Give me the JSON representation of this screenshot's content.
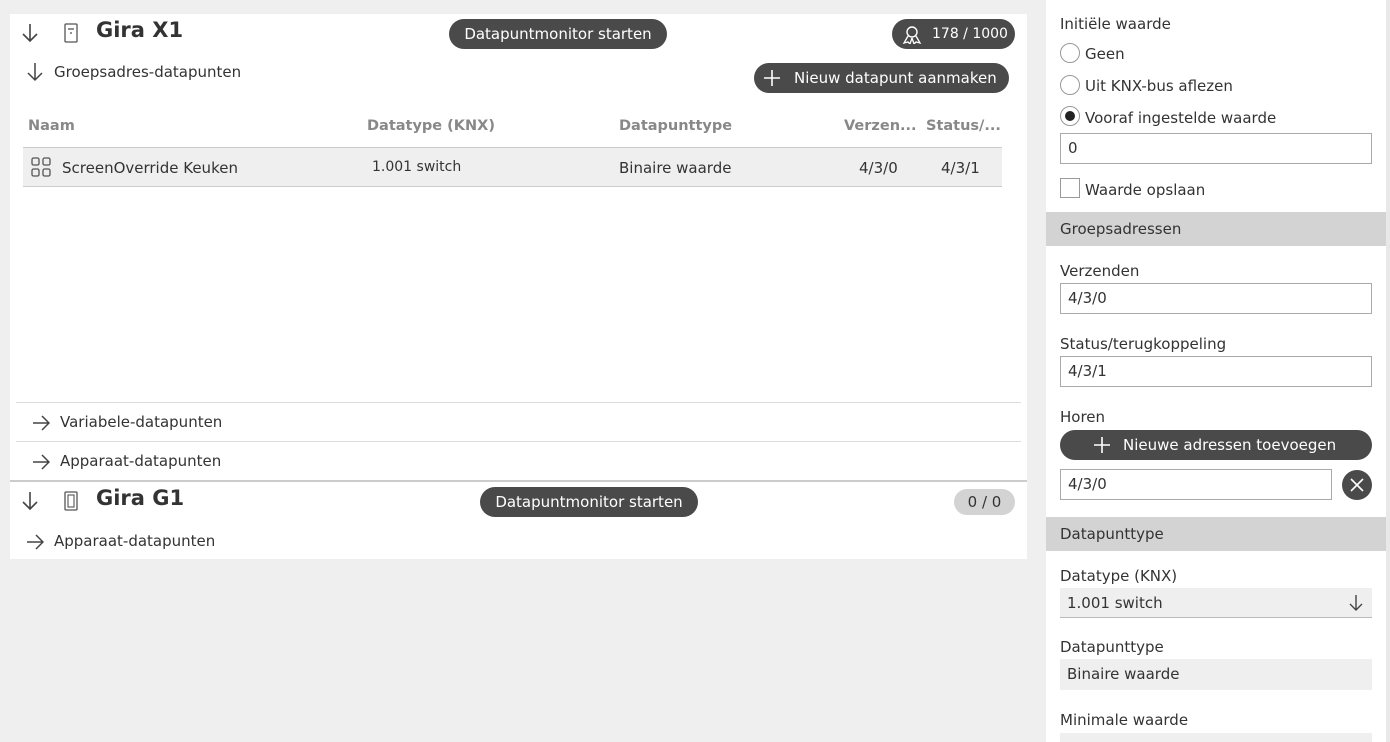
{
  "devices": [
    {
      "name": "Gira X1",
      "monitor_button": "Datapuntmonitor starten",
      "count": "178 / 1000",
      "sections": {
        "group": "Groepsadres-datapunten",
        "new_button": "Nieuw datapunt aanmaken",
        "variable": "Variabele-datapunten",
        "device": "Apparaat-datapunten"
      },
      "table": {
        "headers": [
          "Naam",
          "Datatype (KNX)",
          "Datapunttype",
          "Verzen...",
          "Status/..."
        ],
        "rows": [
          {
            "name": "ScreenOverride Keuken",
            "datatype": "1.001 switch",
            "dptype": "Binaire waarde",
            "send": "4/3/0",
            "status": "4/3/1"
          }
        ]
      }
    },
    {
      "name": "Gira G1",
      "monitor_button": "Datapuntmonitor starten",
      "count": "0 / 0",
      "sections": {
        "device": "Apparaat-datapunten"
      }
    }
  ],
  "panel": {
    "initial_value": {
      "label": "Initiële waarde",
      "options": [
        "Geen",
        "Uit KNX-bus aflezen",
        "Vooraf ingestelde waarde"
      ],
      "selected": "Vooraf ingestelde waarde",
      "value": "0",
      "save_label": "Waarde opslaan"
    },
    "group_addresses": {
      "header": "Groepsadressen",
      "send_label": "Verzenden",
      "send_value": "4/3/0",
      "status_label": "Status/terugkoppeling",
      "status_value": "4/3/1",
      "listen_label": "Horen",
      "add_button": "Nieuwe adressen toevoegen",
      "listen_value": "4/3/0"
    },
    "datapoint_type": {
      "header": "Datapunttype",
      "datatype_label": "Datatype (KNX)",
      "datatype_value": "1.001 switch",
      "dptype_label": "Datapunttype",
      "dptype_value": "Binaire waarde",
      "min_label": "Minimale waarde"
    }
  }
}
